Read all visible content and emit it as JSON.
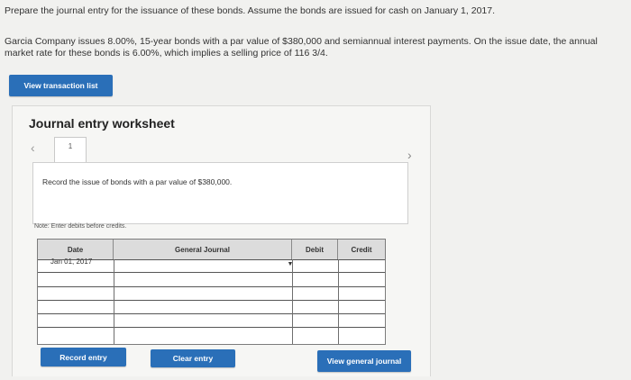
{
  "question": {
    "instruction": "Prepare the journal entry for the issuance of these bonds. Assume the bonds are issued for cash on January 1, 2017.",
    "details": "Garcia Company issues 8.00%, 15-year bonds with a par value of $380,000 and semiannual interest payments. On the issue date, the annual market rate for these bonds is 6.00%, which implies a selling price of 116 3/4."
  },
  "buttons": {
    "view_transaction_list": "View transaction list",
    "record_entry": "Record entry",
    "clear_entry": "Clear entry",
    "view_general_journal": "View general journal"
  },
  "worksheet": {
    "title": "Journal entry worksheet",
    "page_number": "1",
    "instruction": "Record the issue of bonds with a par value of $380,000.",
    "note": "Note: Enter debits before credits."
  },
  "journal_table": {
    "headers": {
      "date": "Date",
      "general_journal": "General Journal",
      "debit": "Debit",
      "credit": "Credit"
    },
    "first_row_date": "Jan 01, 2017"
  },
  "colors": {
    "button": "#2a6fb8",
    "background": "#f1f1ef"
  },
  "icons": {
    "prev": "chevron-left-icon",
    "next": "chevron-right-icon",
    "dropdown": "dropdown-arrow-icon"
  }
}
